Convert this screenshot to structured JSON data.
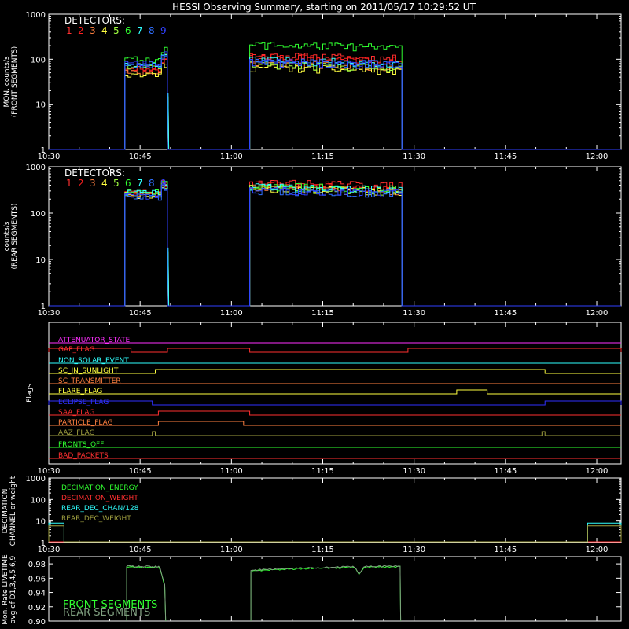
{
  "title": "HESSI Observing Summary, starting on 2011/05/17 10:29:52 UT",
  "colors": {
    "d1": "#ff3030",
    "d2": "#ff2020",
    "d3": "#ff8040",
    "d4": "#ffff40",
    "d5": "#a0ff40",
    "d6": "#30ff30",
    "d7": "#30ffff",
    "d8": "#3070ff",
    "d9": "#3040ff",
    "magenta": "#ff30ff",
    "red": "#ff3030",
    "cyan": "#30ffff",
    "orange": "#ff8040",
    "yellow": "#ffff40",
    "blue": "#3030ff",
    "olive": "#a0a040",
    "green": "#30ff30",
    "grey_green": "#80a080"
  },
  "x_ticks": [
    "10:30",
    "10:45",
    "11:00",
    "11:15",
    "11:30",
    "11:45",
    "12:00"
  ],
  "detectors_label": "DETECTORS:",
  "detector_numbers": [
    "1",
    "2",
    "3",
    "4",
    "5",
    "6",
    "7",
    "8",
    "9"
  ],
  "panels": {
    "front": {
      "ylabel": [
        "MON. counts/s",
        "(FRONT SEGMENTS)"
      ],
      "yticks": [
        "1",
        "10",
        "100",
        "1000"
      ]
    },
    "rear": {
      "ylabel": [
        "counts/s",
        "(REAR SEGMENTS)"
      ],
      "yticks": [
        "1",
        "10",
        "100",
        "1000"
      ]
    },
    "flags": {
      "ylabel": [
        "Flags"
      ]
    },
    "decim": {
      "ylabel": [
        "DECIMATION",
        "CHANNEL or weight"
      ],
      "yticks": [
        "1",
        "10",
        "100",
        "1000"
      ]
    },
    "live": {
      "ylabel": [
        "Mon. Rate LIVETIME",
        "avg of D1,3,4,5,6,9"
      ],
      "yticks": [
        "0.90",
        "0.92",
        "0.94",
        "0.96",
        "0.98"
      ]
    }
  },
  "flag_names": [
    "ATTENUATOR_STATE",
    "GAP_FLAG",
    "NON_SOLAR_EVENT",
    "SC_IN_SUNLIGHT",
    "SC_TRANSMITTER",
    "FLARE_FLAG",
    "ECLIPSE_FLAG",
    "SAA_FLAG",
    "PARTICLE_FLAG",
    "AAZ_FLAG",
    "FRONTS_OFF",
    "BAD_PACKETS"
  ],
  "decim_legend": [
    "DECIMATION_ENERGY",
    "DECIMATION_WEIGHT",
    "REAR_DEC_CHAN/128",
    "REAR_DEC_WEIGHT"
  ],
  "live_legend": [
    "FRONT SEGMENTS",
    "REAR SEGMENTS"
  ],
  "chart_data": [
    {
      "type": "line",
      "title": "HESSI Observing Summary, starting on 2011/05/17 10:29:52 UT",
      "ylabel": "MON. counts/s (FRONT SEGMENTS)",
      "yscale": "log",
      "ylim": [
        1,
        1000
      ],
      "xlim": [
        "10:30",
        "12:04"
      ],
      "x_units": "minutes after 10:30 UT",
      "intervals": [
        [
          12.5,
          19.5
        ],
        [
          33,
          58
        ]
      ],
      "series": [
        {
          "name": "1",
          "levels": [
            65,
            120
          ]
        },
        {
          "name": "2",
          "levels": [
            60,
            110
          ]
        },
        {
          "name": "3",
          "levels": [
            50,
            80
          ]
        },
        {
          "name": "4",
          "levels": [
            45,
            65
          ]
        },
        {
          "name": "5",
          "levels": [
            70,
            75
          ]
        },
        {
          "name": "6",
          "levels": [
            100,
            210
          ]
        },
        {
          "name": "7",
          "levels": [
            75,
            95
          ]
        },
        {
          "name": "8",
          "levels": [
            70,
            90
          ]
        },
        {
          "name": "9",
          "levels": [
            80,
            85
          ]
        }
      ]
    },
    {
      "type": "line",
      "ylabel": "counts/s (REAR SEGMENTS)",
      "yscale": "log",
      "ylim": [
        1,
        1000
      ],
      "xlim": [
        "10:30",
        "12:04"
      ],
      "intervals": [
        [
          12.5,
          19.5
        ],
        [
          33,
          58
        ]
      ],
      "series": [
        {
          "name": "1",
          "levels": [
            280,
            450
          ]
        },
        {
          "name": "2",
          "levels": [
            260,
            400
          ]
        },
        {
          "name": "3",
          "levels": [
            250,
            360
          ]
        },
        {
          "name": "4",
          "levels": [
            240,
            340
          ]
        },
        {
          "name": "5",
          "levels": [
            250,
            350
          ]
        },
        {
          "name": "6",
          "levels": [
            280,
            380
          ]
        },
        {
          "name": "7",
          "levels": [
            270,
            370
          ]
        },
        {
          "name": "8",
          "levels": [
            220,
            300
          ]
        },
        {
          "name": "9",
          "levels": [
            230,
            320
          ]
        }
      ]
    },
    {
      "type": "line",
      "ylabel": "Flags",
      "xlim": [
        "10:30",
        "12:04"
      ],
      "series": [
        {
          "name": "ATTENUATOR_STATE",
          "high_intervals": []
        },
        {
          "name": "GAP_FLAG",
          "high_intervals": [
            [
              0,
              13.5
            ],
            [
              19.5,
              33
            ],
            [
              59,
              94
            ]
          ]
        },
        {
          "name": "NON_SOLAR_EVENT",
          "high_intervals": []
        },
        {
          "name": "SC_IN_SUNLIGHT",
          "high_intervals": [
            [
              17.5,
              81.5
            ]
          ]
        },
        {
          "name": "SC_TRANSMITTER",
          "high_intervals": []
        },
        {
          "name": "FLARE_FLAG",
          "high_intervals": [
            [
              67,
              72
            ]
          ]
        },
        {
          "name": "ECLIPSE_FLAG",
          "high_intervals": [
            [
              0,
              17
            ],
            [
              81.5,
              94
            ]
          ]
        },
        {
          "name": "SAA_FLAG",
          "high_intervals": [
            [
              18,
              33
            ]
          ]
        },
        {
          "name": "PARTICLE_FLAG",
          "high_intervals": [
            [
              18,
              32
            ]
          ]
        },
        {
          "name": "AAZ_FLAG",
          "high_intervals": [
            [
              17,
              17.5
            ],
            [
              81,
              81.5
            ]
          ]
        },
        {
          "name": "FRONTS_OFF",
          "high_intervals": []
        },
        {
          "name": "BAD_PACKETS",
          "high_intervals": []
        }
      ]
    },
    {
      "type": "line",
      "ylabel": "DECIMATION CHANNEL or weight",
      "yscale": "log",
      "ylim": [
        1,
        1000
      ],
      "xlim": [
        "10:30",
        "12:04"
      ],
      "series": [
        {
          "name": "DECIMATION_ENERGY",
          "value": 1
        },
        {
          "name": "DECIMATION_WEIGHT",
          "value": 1
        },
        {
          "name": "REAR_DEC_CHAN/128",
          "value": 8,
          "high_intervals": [
            [
              0,
              2.5
            ],
            [
              88.5,
              94
            ]
          ]
        },
        {
          "name": "REAR_DEC_WEIGHT",
          "value": 6,
          "high_intervals": [
            [
              0,
              2.5
            ],
            [
              88.5,
              94
            ]
          ]
        }
      ]
    },
    {
      "type": "line",
      "ylabel": "Mon. Rate LIVETIME avg of D1,3,4,5,6,9",
      "ylim": [
        0.9,
        0.99
      ],
      "xlim": [
        "10:30",
        "12:04"
      ],
      "series": [
        {
          "name": "FRONT SEGMENTS",
          "segments": [
            [
              12.8,
              19.2,
              0.976,
              0.975
            ],
            [
              33.2,
              57.8,
              0.969,
              0.976
            ]
          ]
        },
        {
          "name": "REAR SEGMENTS",
          "segments": [
            [
              12.8,
              19.2,
              0.977,
              0.976
            ],
            [
              33.2,
              57.8,
              0.97,
              0.977
            ]
          ]
        }
      ]
    }
  ]
}
